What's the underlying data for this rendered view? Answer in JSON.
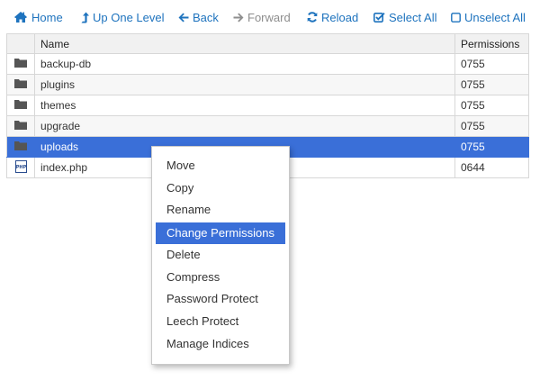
{
  "toolbar": {
    "home": "Home",
    "up_one_level": "Up One Level",
    "back": "Back",
    "forward": "Forward",
    "reload": "Reload",
    "select_all": "Select All",
    "unselect_all": "Unselect All"
  },
  "table": {
    "headers": {
      "name": "Name",
      "permissions": "Permissions"
    },
    "rows": [
      {
        "name": "backup-db",
        "permissions": "0755",
        "type": "folder"
      },
      {
        "name": "plugins",
        "permissions": "0755",
        "type": "folder"
      },
      {
        "name": "themes",
        "permissions": "0755",
        "type": "folder"
      },
      {
        "name": "upgrade",
        "permissions": "0755",
        "type": "folder"
      },
      {
        "name": "uploads",
        "permissions": "0755",
        "type": "folder",
        "selected": true
      },
      {
        "name": "index.php",
        "permissions": "0644",
        "type": "php-file"
      }
    ]
  },
  "context_menu": {
    "items": [
      "Move",
      "Copy",
      "Rename",
      "Change Permissions",
      "Delete",
      "Compress",
      "Password Protect",
      "Leech Protect",
      "Manage Indices"
    ],
    "highlighted": "Change Permissions"
  },
  "colors": {
    "link": "#1e73be",
    "disabled": "#8e8e8e",
    "selection": "#3a6fd8"
  }
}
